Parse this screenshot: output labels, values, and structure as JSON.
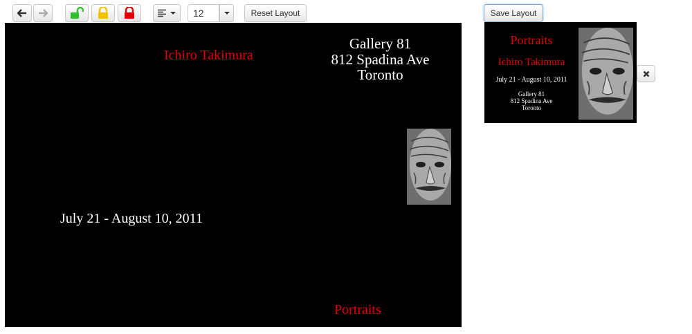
{
  "toolbar": {
    "icons": [
      "arrow-left-icon",
      "arrow-right-icon",
      "lock-open-icon",
      "lock-yellow-icon",
      "lock-red-icon",
      "align-left-icon",
      "chevron-down-icon"
    ],
    "font_size": "12",
    "reset_label": "Reset Layout",
    "save_label": "Save Layout",
    "colors": {
      "unlock": "#2fbf2f",
      "lock_partial": "#f2c200",
      "lock_full": "#e00000"
    }
  },
  "canvas": {
    "artist": "Ichiro Takimura",
    "gallery": [
      "Gallery 81",
      "812 Spadina Ave",
      "Toronto"
    ],
    "dates": "July 21 - August 10, 2011",
    "title": "Portraits",
    "accent_color": "#e00000",
    "background": "#000000"
  },
  "preview": {
    "title": "Portraits",
    "artist": "Ichiro Takimura",
    "dates": "July 21 - August 10, 2011",
    "gallery": [
      "Gallery 81",
      "812 Spadina Ave",
      "Toronto"
    ]
  },
  "close_icon": "close-icon"
}
